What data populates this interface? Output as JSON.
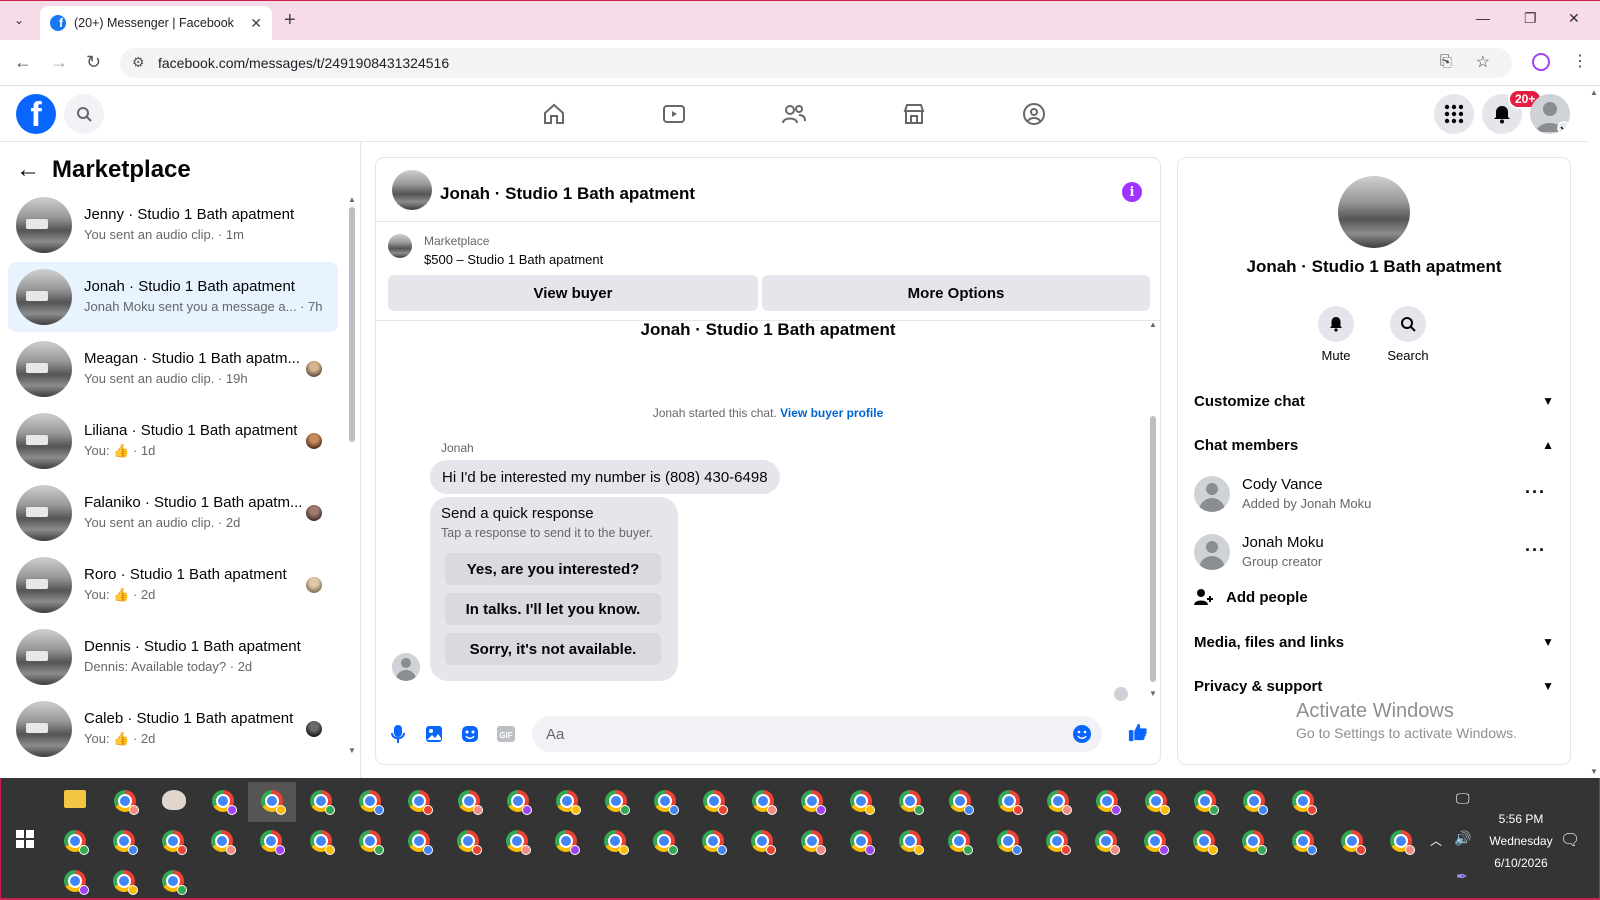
{
  "browser": {
    "tab_title": "(20+) Messenger | Facebook",
    "url": "facebook.com/messages/t/2491908431324516"
  },
  "header": {
    "notification_badge": "20+"
  },
  "left": {
    "title": "Marketplace",
    "conversations": [
      {
        "name": "Jenny · Studio 1 Bath apatment",
        "sub": "You sent an audio clip. · 1m"
      },
      {
        "name": "Jonah · Studio 1 Bath apatment",
        "sub": "Jonah Moku sent you a message a... · 7h"
      },
      {
        "name": "Meagan · Studio 1 Bath apatm...",
        "sub": "You sent an audio clip. · 19h"
      },
      {
        "name": "Liliana · Studio 1 Bath apatment",
        "sub": "You: 👍 · 1d"
      },
      {
        "name": "Falaniko · Studio 1 Bath apatm...",
        "sub": "You sent an audio clip. · 2d"
      },
      {
        "name": "Roro · Studio 1 Bath apatment",
        "sub": "You: 👍 · 2d"
      },
      {
        "name": "Dennis · Studio 1 Bath apatment",
        "sub": "Dennis: Available today? · 2d"
      },
      {
        "name": "Caleb · Studio 1 Bath apatment",
        "sub": "You: 👍 · 2d"
      }
    ]
  },
  "chat": {
    "title": "Jonah · Studio 1 Bath apatment",
    "listing_source": "Marketplace",
    "listing_item": "$500 – Studio 1 Bath apatment",
    "view_buyer": "View buyer",
    "more_options": "More Options",
    "thread_title": "Jonah · Studio 1 Bath apatment",
    "started_text": "Jonah started this chat.",
    "view_buyer_profile": "View buyer profile",
    "sender": "Jonah",
    "message": "Hi I'd be interested my number is (808) 430-6498",
    "quick_title": "Send a quick response",
    "quick_sub": "Tap a response to send it to the buyer.",
    "quick_replies": [
      "Yes, are you interested?",
      "In talks. I'll let you know.",
      "Sorry, it's not available."
    ],
    "input_placeholder": "Aa"
  },
  "right": {
    "name": "Jonah · Studio 1 Bath apatment",
    "mute": "Mute",
    "search": "Search",
    "customize": "Customize chat",
    "members_title": "Chat members",
    "members": [
      {
        "name": "Cody Vance",
        "sub": "Added by Jonah Moku"
      },
      {
        "name": "Jonah Moku",
        "sub": "Group creator"
      }
    ],
    "add_people": "Add people",
    "media": "Media, files and links",
    "privacy": "Privacy & support"
  },
  "watermark": {
    "line1": "Activate Windows",
    "line2": "Go to Settings to activate Windows."
  },
  "taskbar": {
    "time": "5:56 PM",
    "day": "Wednesday",
    "date": "6/10/2026"
  },
  "colors": {
    "facebook_blue": "#0866ff",
    "link_blue": "#0064d1",
    "info_purple": "#a033ff",
    "active_row": "#e7f3ff"
  }
}
